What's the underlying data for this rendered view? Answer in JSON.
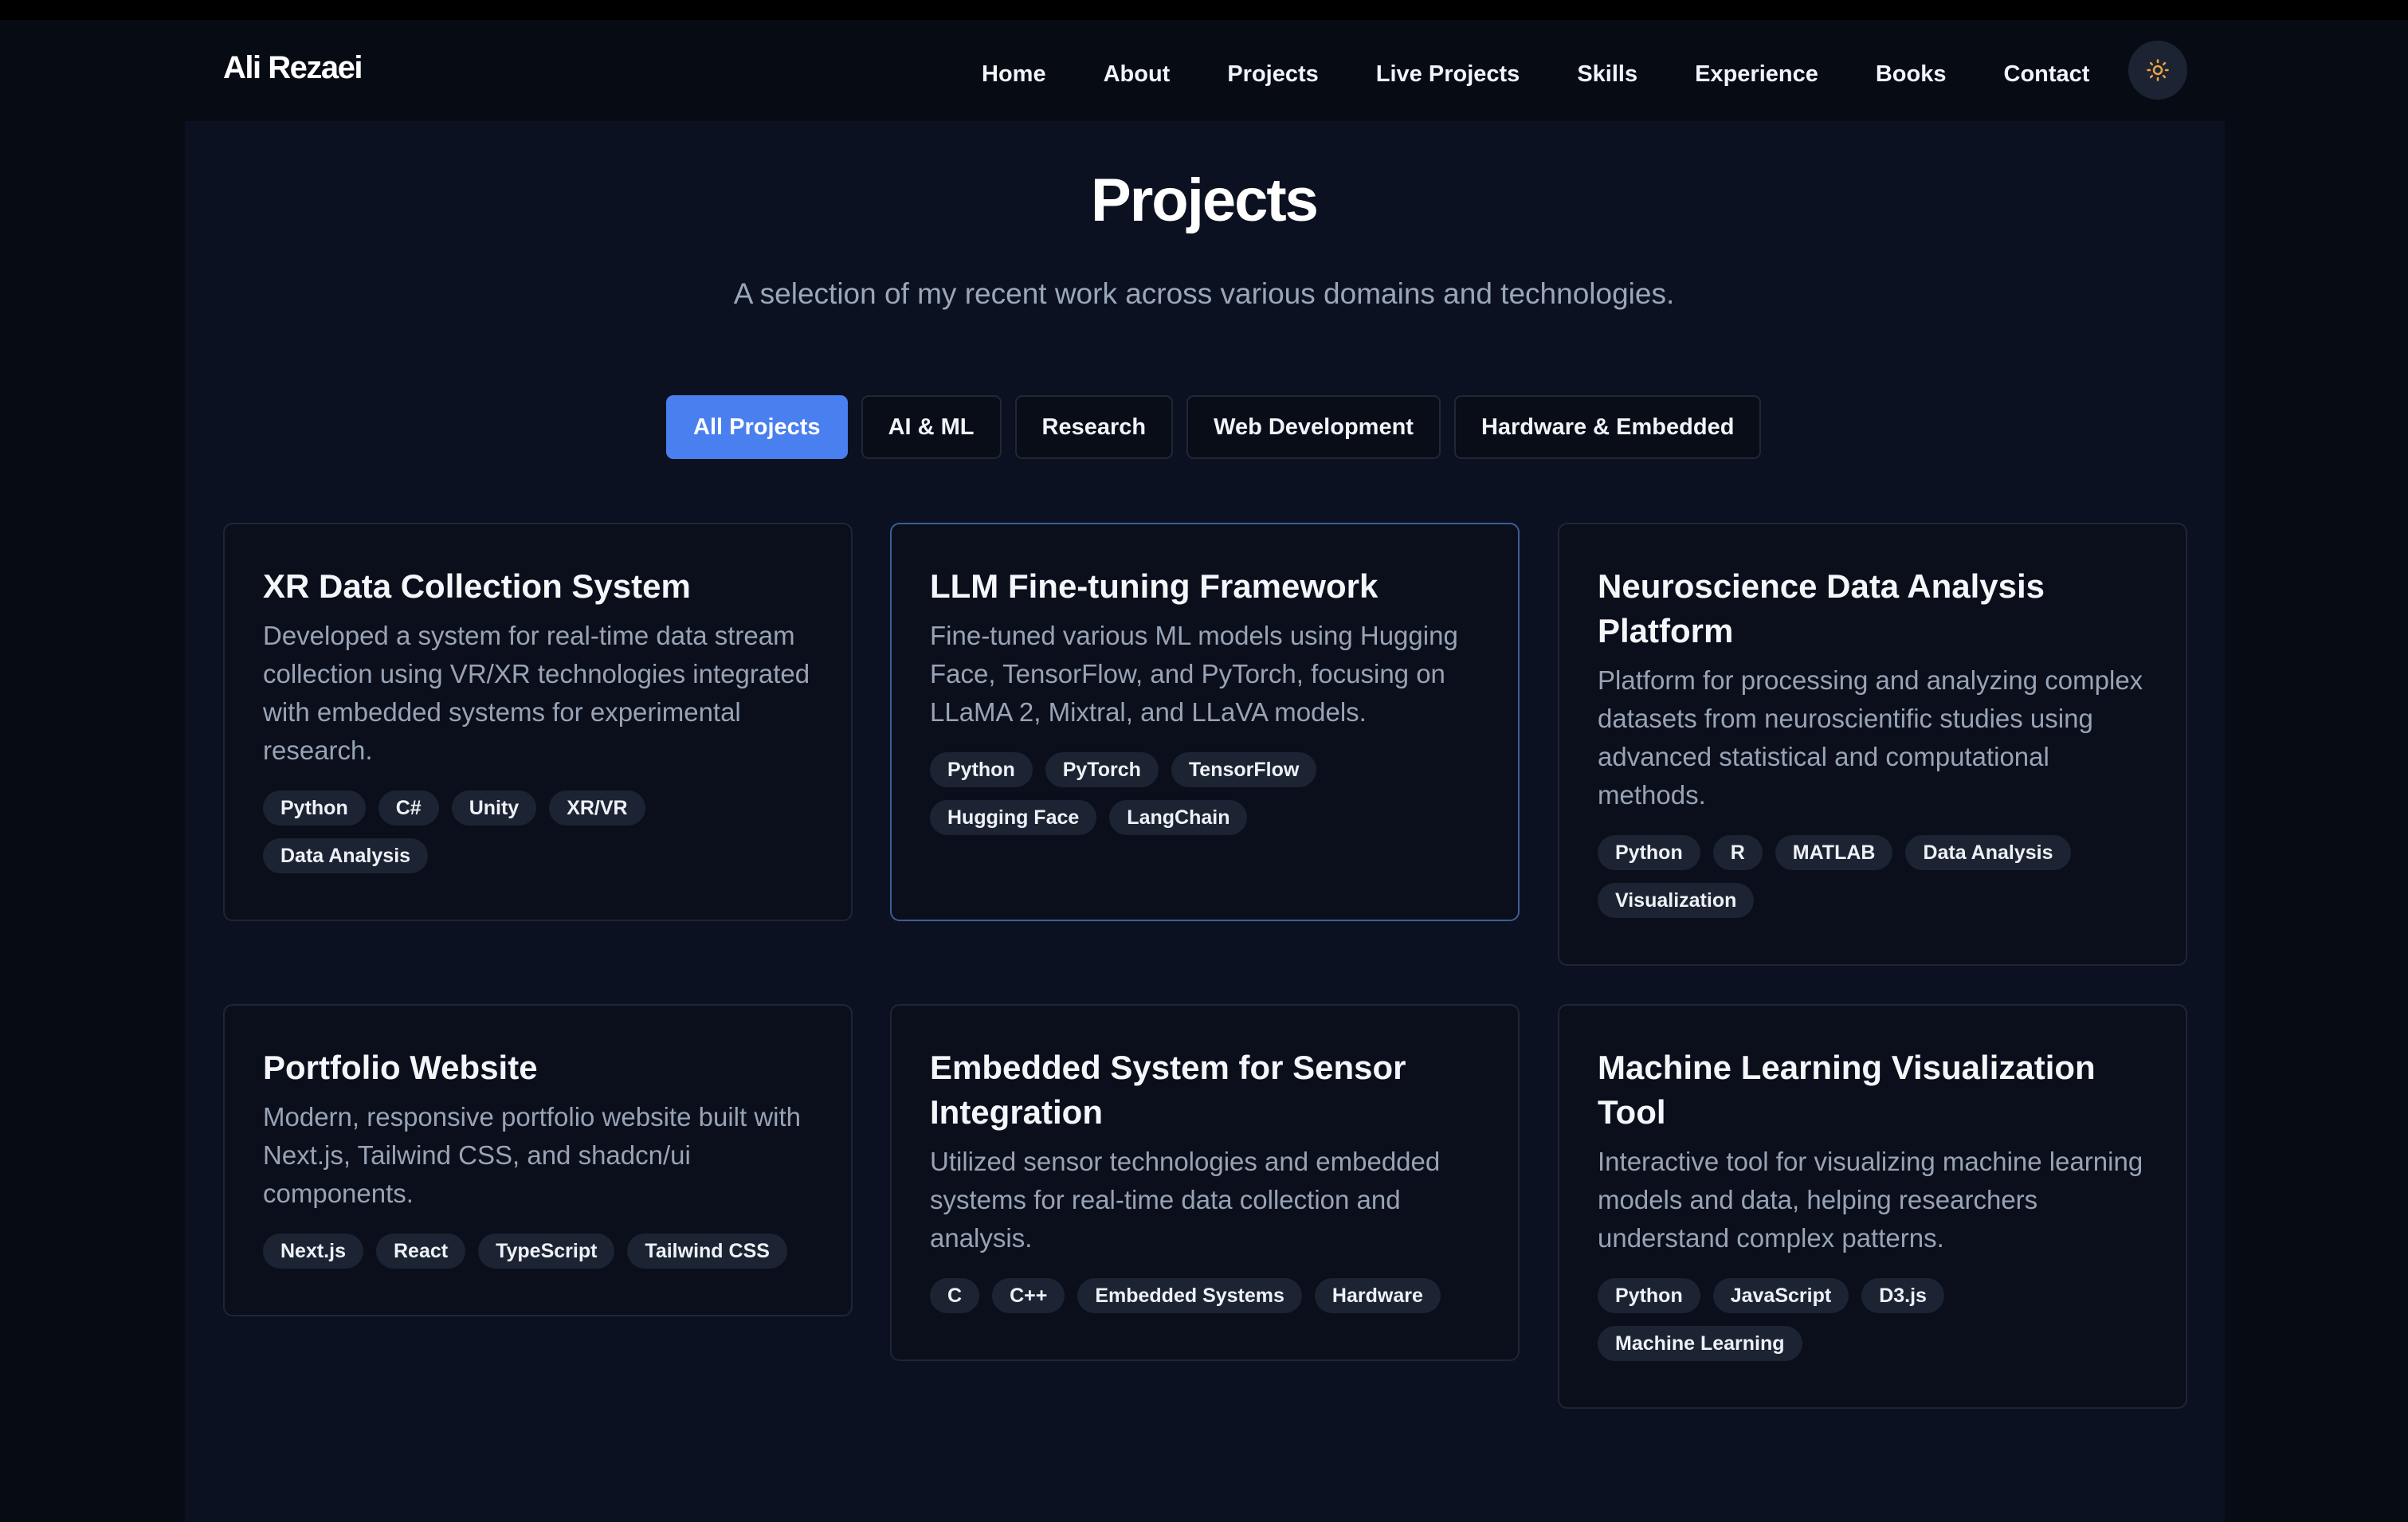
{
  "header": {
    "logo": "Ali Rezaei",
    "nav": [
      "Home",
      "About",
      "Projects",
      "Live Projects",
      "Skills",
      "Experience",
      "Books",
      "Contact"
    ],
    "theme_icon": "sun-icon"
  },
  "page": {
    "title": "Projects",
    "subtitle": "A selection of my recent work across various domains and technologies."
  },
  "filters": [
    "All Projects",
    "AI & ML",
    "Research",
    "Web Development",
    "Hardware & Embedded"
  ],
  "active_filter": "All Projects",
  "colors": {
    "accent": "#4a7ff0",
    "background": "#0b1120",
    "card_border": "#1e2635",
    "card_border_highlight": "#3f5c97",
    "tag_bg": "#1c2433",
    "muted_text": "#98a3b5",
    "sun_icon": "#f0a340"
  },
  "projects": [
    {
      "title": "XR Data Collection System",
      "description": "Developed a system for real-time data stream collection using VR/XR technologies integrated with embedded systems for experimental research.",
      "tags": [
        "Python",
        "C#",
        "Unity",
        "XR/VR",
        "Data Analysis"
      ]
    },
    {
      "title": "LLM Fine-tuning Framework",
      "description": "Fine-tuned various ML models using Hugging Face, TensorFlow, and PyTorch, focusing on LLaMA 2, Mixtral, and LLaVA models.",
      "tags": [
        "Python",
        "PyTorch",
        "TensorFlow",
        "Hugging Face",
        "LangChain"
      ],
      "highlighted": true
    },
    {
      "title": "Neuroscience Data Analysis Platform",
      "description": "Platform for processing and analyzing complex datasets from neuroscientific studies using advanced statistical and computational methods.",
      "tags": [
        "Python",
        "R",
        "MATLAB",
        "Data Analysis",
        "Visualization"
      ]
    },
    {
      "title": "Portfolio Website",
      "description": "Modern, responsive portfolio website built with Next.js, Tailwind CSS, and shadcn/ui components.",
      "tags": [
        "Next.js",
        "React",
        "TypeScript",
        "Tailwind CSS"
      ]
    },
    {
      "title": "Embedded System for Sensor Integration",
      "description": "Utilized sensor technologies and embedded systems for real-time data collection and analysis.",
      "tags": [
        "C",
        "C++",
        "Embedded Systems",
        "Hardware"
      ]
    },
    {
      "title": "Machine Learning Visualization Tool",
      "description": "Interactive tool for visualizing machine learning models and data, helping researchers understand complex patterns.",
      "tags": [
        "Python",
        "JavaScript",
        "D3.js",
        "Machine Learning"
      ]
    }
  ]
}
